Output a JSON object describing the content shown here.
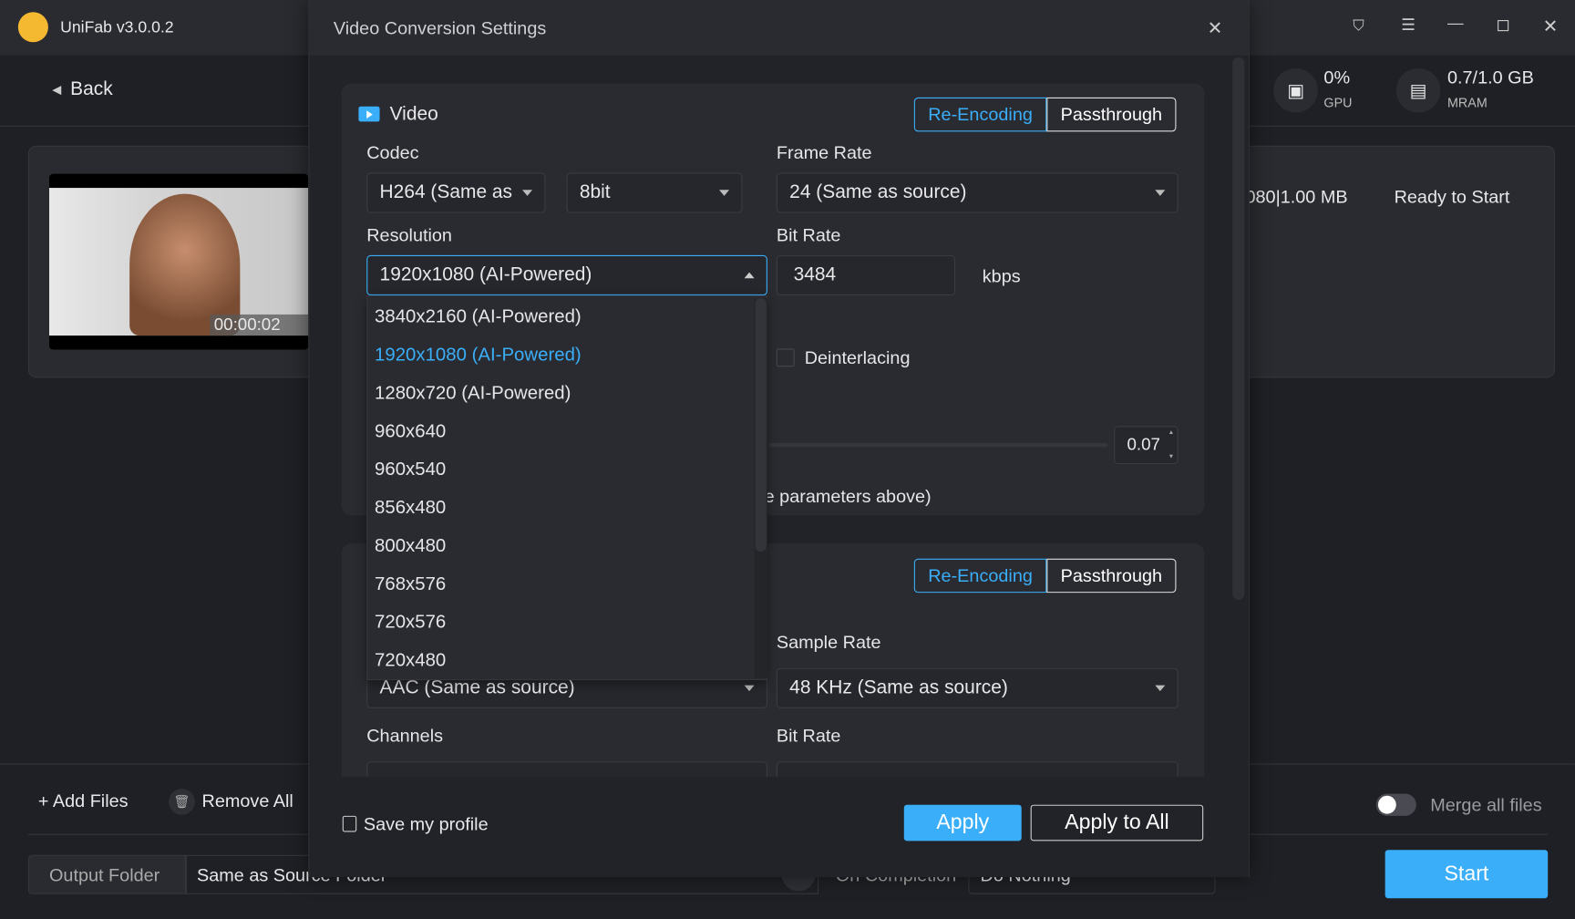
{
  "app": {
    "title": "UniFab v3.0.0.2",
    "back_label": "Back",
    "gpu": {
      "value": "0%",
      "label": "GPU"
    },
    "mram": {
      "value": "0.7/1.0 GB",
      "label": "MRAM"
    }
  },
  "file": {
    "duration": "00:00:02",
    "info": "080|1.00 MB",
    "status": "Ready to Start"
  },
  "bottom": {
    "add_files": "Add Files",
    "remove_all": "Remove All",
    "merge_label": "Merge all files",
    "merge_on": false,
    "output_folder_label": "Output Folder",
    "output_folder_value": "Same as Source Folder",
    "on_completion_label": "On Completion",
    "on_completion_value": "Do Nothing",
    "start": "Start"
  },
  "dialog": {
    "title": "Video Conversion Settings",
    "video": {
      "title": "Video",
      "mode_reencode": "Re-Encoding",
      "mode_passthrough": "Passthrough",
      "codec_label": "Codec",
      "codec_value": "H264 (Same as",
      "bitdepth_value": "8bit",
      "framerate_label": "Frame Rate",
      "framerate_value": "24 (Same as source)",
      "resolution_label": "Resolution",
      "resolution_value": "1920x1080 (AI-Powered)",
      "bitrate_label": "Bit Rate",
      "bitrate_value": "3484",
      "bitrate_unit": "kbps",
      "deinterlacing_label": "Deinterlacing",
      "deinterlacing_checked": false,
      "spin_value": "0.07",
      "note_partial": "e parameters above)"
    },
    "resolution_options": [
      "3840x2160 (AI-Powered)",
      "1920x1080 (AI-Powered)",
      "1280x720 (AI-Powered)",
      "960x640",
      "960x540",
      "856x480",
      "800x480",
      "768x576",
      "720x576",
      "720x480"
    ],
    "resolution_selected_index": 1,
    "audio": {
      "mode_reencode": "Re-Encoding",
      "mode_passthrough": "Passthrough",
      "codec_value": "AAC (Same as source)",
      "samplerate_label": "Sample Rate",
      "samplerate_value": "48 KHz (Same as source)",
      "channels_label": "Channels",
      "bitrate_label": "Bit Rate"
    },
    "save_profile": "Save my profile",
    "apply": "Apply",
    "apply_all": "Apply to All"
  },
  "colors": {
    "accent": "#3aaef8",
    "background": "#1f2025",
    "panel": "#2a2b30"
  }
}
